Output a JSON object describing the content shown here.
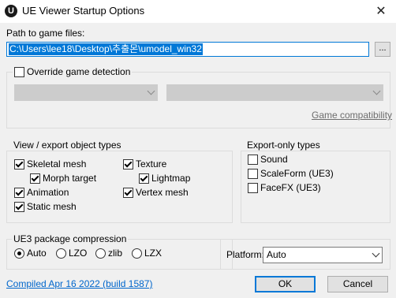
{
  "window": {
    "title": "UE Viewer Startup Options",
    "app_icon_glyph": "U",
    "close_glyph": "✕"
  },
  "path": {
    "label": "Path to game files:",
    "value": "C:\\Users\\lee18\\Desktop\\추출몬\\umodel_win32",
    "browse_label": "..."
  },
  "override": {
    "label": "Override game detection",
    "checked": false,
    "compat_link": "Game compatibility"
  },
  "view_export": {
    "title": "View / export object types",
    "items": [
      {
        "label": "Skeletal mesh",
        "checked": true
      },
      {
        "label": "Morph target",
        "checked": true
      },
      {
        "label": "Animation",
        "checked": true
      },
      {
        "label": "Static mesh",
        "checked": true
      },
      {
        "label": "Texture",
        "checked": true
      },
      {
        "label": "Lightmap",
        "checked": true
      },
      {
        "label": "Vertex mesh",
        "checked": true
      }
    ]
  },
  "export_only": {
    "title": "Export-only types",
    "items": [
      {
        "label": "Sound",
        "checked": false
      },
      {
        "label": "ScaleForm (UE3)",
        "checked": false
      },
      {
        "label": "FaceFX (UE3)",
        "checked": false
      }
    ]
  },
  "compression": {
    "title": "UE3 package compression",
    "options": [
      {
        "label": "Auto",
        "selected": true
      },
      {
        "label": "LZO",
        "selected": false
      },
      {
        "label": "zlib",
        "selected": false
      },
      {
        "label": "LZX",
        "selected": false
      }
    ]
  },
  "platform": {
    "label": "Platform:",
    "value": "Auto"
  },
  "footer": {
    "compiled_link": "Compiled Apr 16 2022 (build 1587)",
    "ok_label": "OK",
    "cancel_label": "Cancel"
  },
  "colors": {
    "accent": "#0078d7",
    "link": "#0066cc"
  }
}
